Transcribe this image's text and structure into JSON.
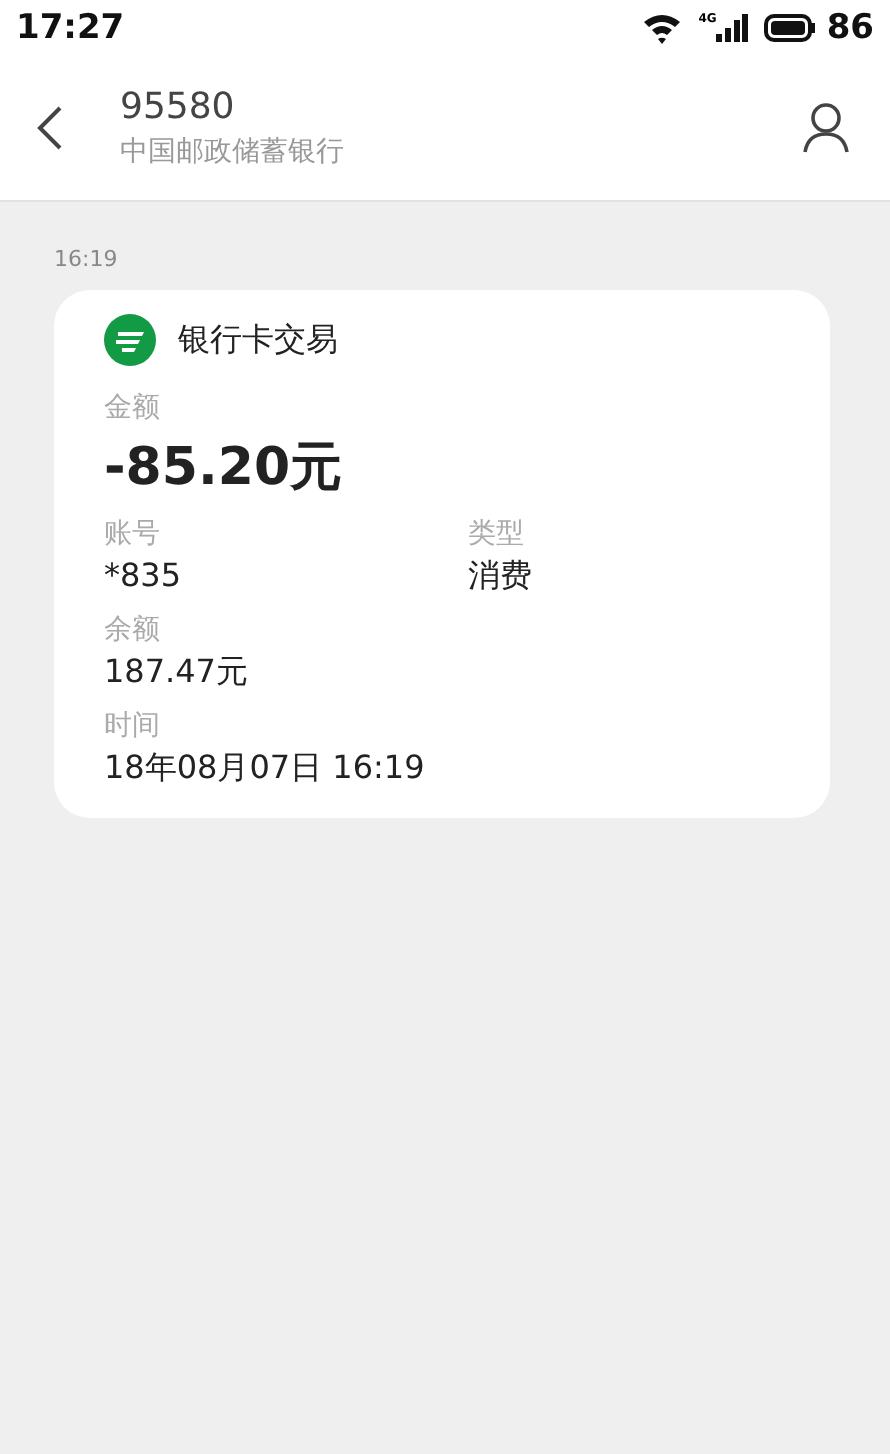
{
  "status_bar": {
    "time": "17:27",
    "network": "4G",
    "battery": "86"
  },
  "header": {
    "title": "95580",
    "subtitle": "中国邮政储蓄银行"
  },
  "message": {
    "time": "16:19",
    "card": {
      "title": "银行卡交易",
      "fields": [
        {
          "kind": "amount",
          "label": "金额",
          "value": "-85.20元"
        },
        {
          "kind": "pair",
          "items": [
            {
              "label": "账号",
              "value": "*835"
            },
            {
              "label": "类型",
              "value": "消费"
            }
          ]
        },
        {
          "kind": "plain",
          "label": "余额",
          "value": "187.47元"
        },
        {
          "kind": "plain",
          "label": "时间",
          "value": "18年08月07日 16:19"
        }
      ]
    }
  }
}
